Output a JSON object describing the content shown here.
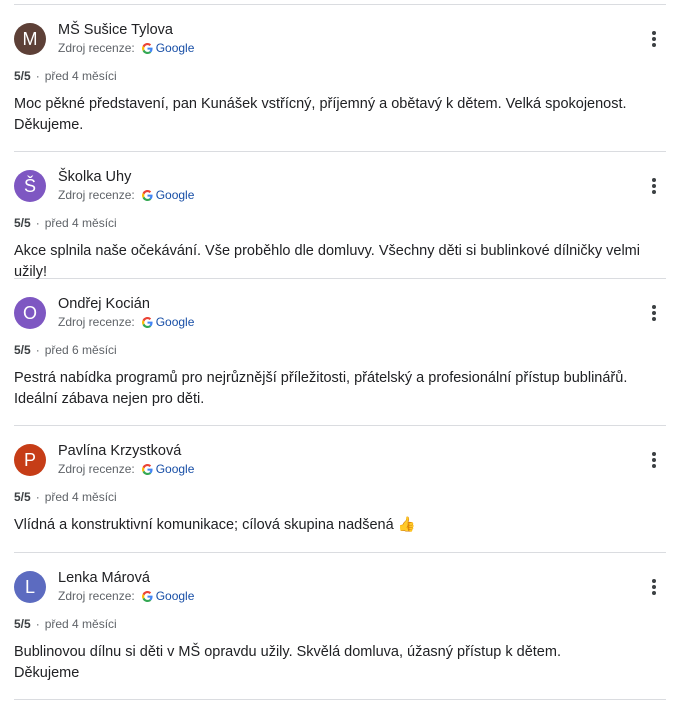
{
  "source_label": "Zdroj recenze:",
  "source_name": "Google",
  "reviews": [
    {
      "initial": "M",
      "avatar_color": "#5d4037",
      "author": "MŠ Sušice Tylova",
      "rating": "5/5",
      "time": "před 4 měsíci",
      "text": "Moc pěkné představení, pan Kunášek vstřícný, příjemný a obětavý k dětem. Velká spokojenost. Děkujeme."
    },
    {
      "initial": "Š",
      "avatar_color": "#7e57c2",
      "author": "Školka Uhy",
      "rating": "5/5",
      "time": "před 4 měsíci",
      "text": "Akce splnila naše očekávání. Vše proběhlo dle domluvy. Všechny děti si bublinkové dílničky velmi užily!"
    },
    {
      "initial": "O",
      "avatar_color": "#7e57c2",
      "author": "Ondřej Kocián",
      "rating": "5/5",
      "time": "před 6 měsíci",
      "text": "Pestrá nabídka programů pro nejrůznější příležitosti, přátelský a profesionální přístup bublinářů. Ideální zábava nejen pro děti."
    },
    {
      "initial": "P",
      "avatar_color": "#c63d17",
      "author": "Pavlína Krzystková",
      "rating": "5/5",
      "time": "před 4 měsíci",
      "text": "Vlídná a konstruktivní komunikace; cílová skupina nadšená 👍"
    },
    {
      "initial": "L",
      "avatar_color": "#5c6bc0",
      "author": "Lenka Márová",
      "rating": "5/5",
      "time": "před 4 měsíci",
      "text": "Bublinovou dílnu si děti v MŠ opravdu užily. Skvělá domluva, úžasný přístup k dětem.\nDěkujeme"
    }
  ]
}
